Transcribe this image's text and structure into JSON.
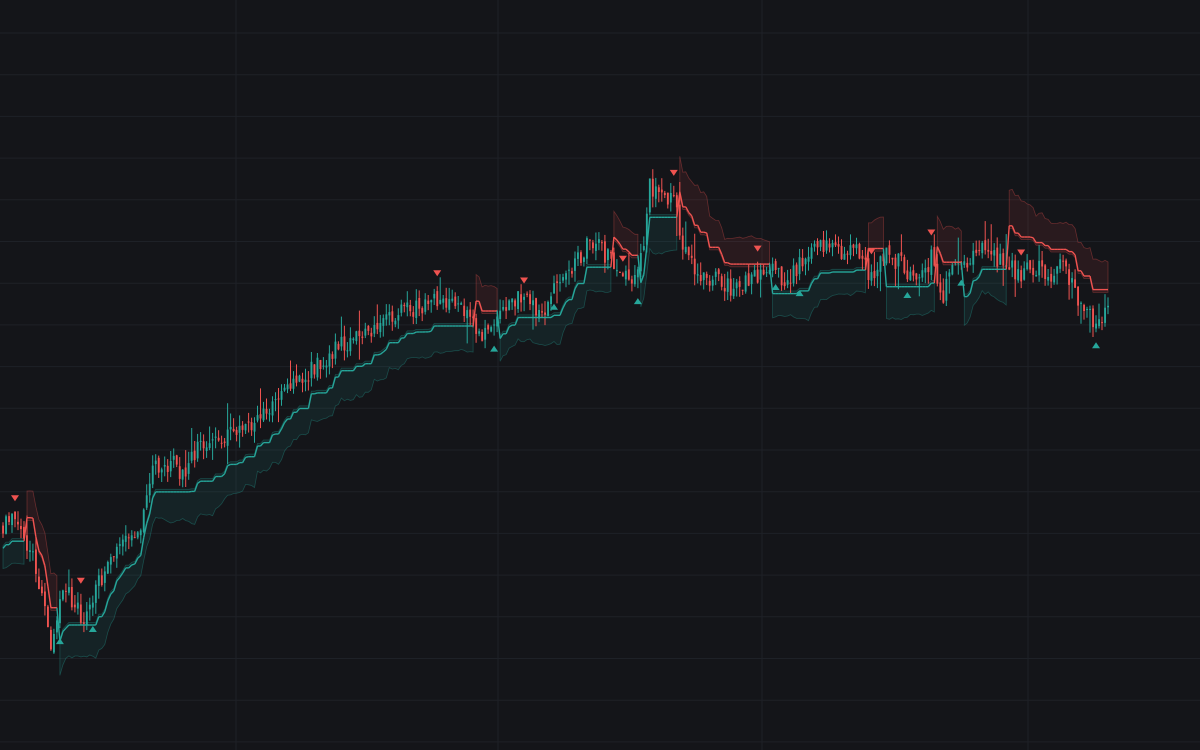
{
  "theme": {
    "background": "#141519",
    "grid": "#1e2127",
    "bull": "#26a69a",
    "bear": "#ef5350"
  },
  "chart_data": {
    "type": "candlestick",
    "title": "",
    "xlabel": "",
    "ylabel": "",
    "x_axis_labels": [],
    "y_axis_labels": [],
    "grid": true,
    "legend": "none",
    "ylim": [
      0,
      100
    ],
    "bar_count": 370,
    "anchors": [
      [
        0,
        55.5
      ],
      [
        4,
        58
      ],
      [
        10,
        50
      ],
      [
        14,
        40
      ],
      [
        16,
        33
      ],
      [
        20,
        45
      ],
      [
        24,
        40
      ],
      [
        27,
        38
      ],
      [
        30,
        42
      ],
      [
        34,
        47
      ],
      [
        40,
        54
      ],
      [
        46,
        56
      ],
      [
        50,
        67
      ],
      [
        56,
        68
      ],
      [
        60,
        66
      ],
      [
        64,
        70
      ],
      [
        68,
        71
      ],
      [
        72,
        73
      ],
      [
        78,
        74
      ],
      [
        84,
        76
      ],
      [
        88,
        78
      ],
      [
        92,
        80
      ],
      [
        96,
        82
      ],
      [
        100,
        84
      ],
      [
        106,
        87
      ],
      [
        112,
        90
      ],
      [
        118,
        92
      ],
      [
        124,
        94
      ],
      [
        130,
        96
      ],
      [
        136,
        97
      ],
      [
        140,
        98
      ],
      [
        146,
        100
      ],
      [
        152,
        98
      ],
      [
        156,
        95
      ],
      [
        160,
        93
      ],
      [
        164,
        96
      ],
      [
        170,
        99
      ],
      [
        176,
        99
      ],
      [
        180,
        95
      ],
      [
        184,
        101
      ],
      [
        190,
        105
      ],
      [
        194,
        109
      ],
      [
        198,
        110
      ],
      [
        204,
        106
      ],
      [
        210,
        103
      ],
      [
        214,
        110
      ],
      [
        216,
        121
      ],
      [
        220,
        119
      ],
      [
        224,
        118
      ],
      [
        228,
        108
      ],
      [
        234,
        103
      ],
      [
        238,
        104
      ],
      [
        244,
        101
      ],
      [
        250,
        103
      ],
      [
        256,
        106
      ],
      [
        262,
        102
      ],
      [
        268,
        108
      ],
      [
        274,
        109
      ],
      [
        280,
        108
      ],
      [
        286,
        108
      ],
      [
        290,
        103
      ],
      [
        294,
        108
      ],
      [
        300,
        106
      ],
      [
        306,
        102
      ],
      [
        310,
        107
      ],
      [
        314,
        100
      ],
      [
        318,
        106
      ],
      [
        322,
        107
      ],
      [
        326,
        109
      ],
      [
        330,
        108
      ],
      [
        334,
        106
      ],
      [
        340,
        104
      ],
      [
        346,
        106
      ],
      [
        350,
        103
      ],
      [
        354,
        106
      ],
      [
        358,
        100
      ],
      [
        362,
        98
      ],
      [
        365,
        93
      ],
      [
        368,
        97
      ]
    ],
    "signals": [
      {
        "bar": 4,
        "type": "sell"
      },
      {
        "bar": 19,
        "type": "buy"
      },
      {
        "bar": 26,
        "type": "sell"
      },
      {
        "bar": 30,
        "type": "buy"
      },
      {
        "bar": 145,
        "type": "sell"
      },
      {
        "bar": 164,
        "type": "buy"
      },
      {
        "bar": 174,
        "type": "sell"
      },
      {
        "bar": 184,
        "type": "buy"
      },
      {
        "bar": 207,
        "type": "sell"
      },
      {
        "bar": 212,
        "type": "buy"
      },
      {
        "bar": 224,
        "type": "sell"
      },
      {
        "bar": 252,
        "type": "sell"
      },
      {
        "bar": 258,
        "type": "buy"
      },
      {
        "bar": 266,
        "type": "buy"
      },
      {
        "bar": 290,
        "type": "sell"
      },
      {
        "bar": 302,
        "type": "buy"
      },
      {
        "bar": 310,
        "type": "sell"
      },
      {
        "bar": 320,
        "type": "buy"
      },
      {
        "bar": 340,
        "type": "sell"
      },
      {
        "bar": 365,
        "type": "buy"
      }
    ]
  }
}
